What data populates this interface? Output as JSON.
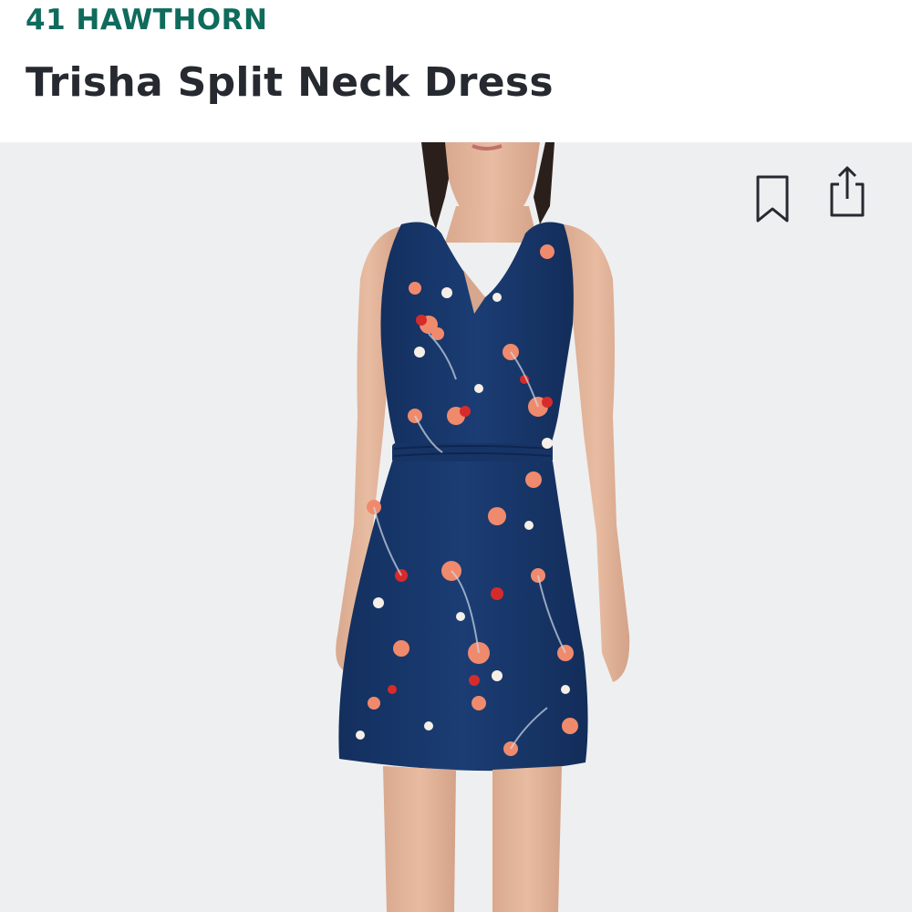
{
  "product": {
    "brand": "41 HAWTHORN",
    "name": "Trisha Split Neck Dress"
  },
  "actions": {
    "bookmark_icon": "bookmark-icon",
    "share_icon": "share-icon"
  },
  "colors": {
    "brand": "#0f6b5c",
    "title": "#262a30",
    "photo_background": "#eeeff1",
    "dress_navy": "#1a3a6e",
    "flower_coral": "#f08a6c",
    "flower_red": "#d62b2b"
  }
}
